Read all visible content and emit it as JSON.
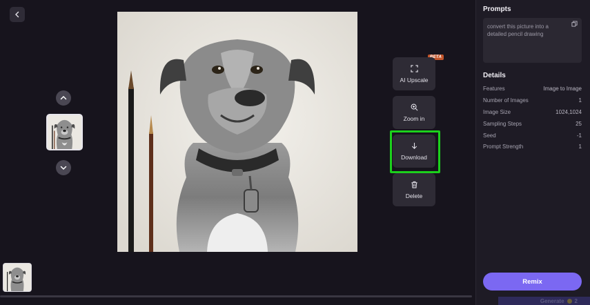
{
  "nav": {
    "back_icon": "chevron-left-icon",
    "up_icon": "chevron-up-icon",
    "down_icon": "chevron-down-icon"
  },
  "tools": {
    "upscale_label": "AI Upscale",
    "upscale_badge": "BETA",
    "zoom_label": "Zoom in",
    "download_label": "Download",
    "delete_label": "Delete"
  },
  "panel": {
    "prompts_title": "Prompts",
    "prompt_text": "convert this picture into a detailed pencil drawing",
    "details_title": "Details",
    "details": [
      {
        "label": "Features",
        "value": "Image to Image"
      },
      {
        "label": "Number of Images",
        "value": "1"
      },
      {
        "label": "Image Size",
        "value": "1024,1024"
      },
      {
        "label": "Sampling Steps",
        "value": "25"
      },
      {
        "label": "Seed",
        "value": "-1"
      },
      {
        "label": "Prompt Strength",
        "value": "1"
      }
    ],
    "remix_label": "Remix",
    "generate_label": "Generate",
    "generate_cost": "2"
  },
  "colors": {
    "accent": "#7b68f2",
    "highlight": "#1cd11c",
    "beta_badge": "#c2552b"
  }
}
